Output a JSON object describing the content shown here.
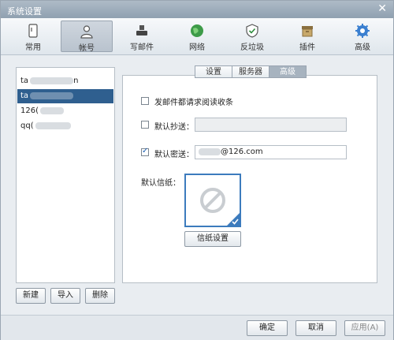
{
  "window": {
    "title": "系统设置",
    "close": "✕"
  },
  "toolbar": {
    "items": [
      {
        "label": "常用",
        "icon": "phone-icon"
      },
      {
        "label": "帐号",
        "icon": "person-icon"
      },
      {
        "label": "写邮件",
        "icon": "stamp-icon"
      },
      {
        "label": "网络",
        "icon": "globe-icon"
      },
      {
        "label": "反垃圾",
        "icon": "shield-icon"
      },
      {
        "label": "插件",
        "icon": "box-icon"
      },
      {
        "label": "高级",
        "icon": "gear-icon"
      }
    ],
    "active_index": 1
  },
  "accounts": [
    {
      "prefix": "ta",
      "suffix": "n"
    },
    {
      "prefix": "ta",
      "suffix": ""
    },
    {
      "prefix": "126(",
      "suffix": ""
    },
    {
      "prefix": "qq(",
      "suffix": ""
    }
  ],
  "left_buttons": {
    "new": "新建",
    "import": "导入",
    "delete": "删除"
  },
  "tabs": [
    "设置",
    "服务器",
    "高级"
  ],
  "settings": {
    "read_receipt_label": "发邮件都请求阅读收条",
    "cc_label": "默认抄送：",
    "bcc_label": "默认密送：",
    "bcc_value_suffix": "@126.com",
    "stationery_label": "默认信纸：",
    "stationery_button": "信纸设置"
  },
  "footer": {
    "ok": "确定",
    "cancel": "取消",
    "apply": "应用(A)"
  },
  "colors": {
    "accent": "#2f5f8f",
    "check": "#1a5fb4"
  }
}
